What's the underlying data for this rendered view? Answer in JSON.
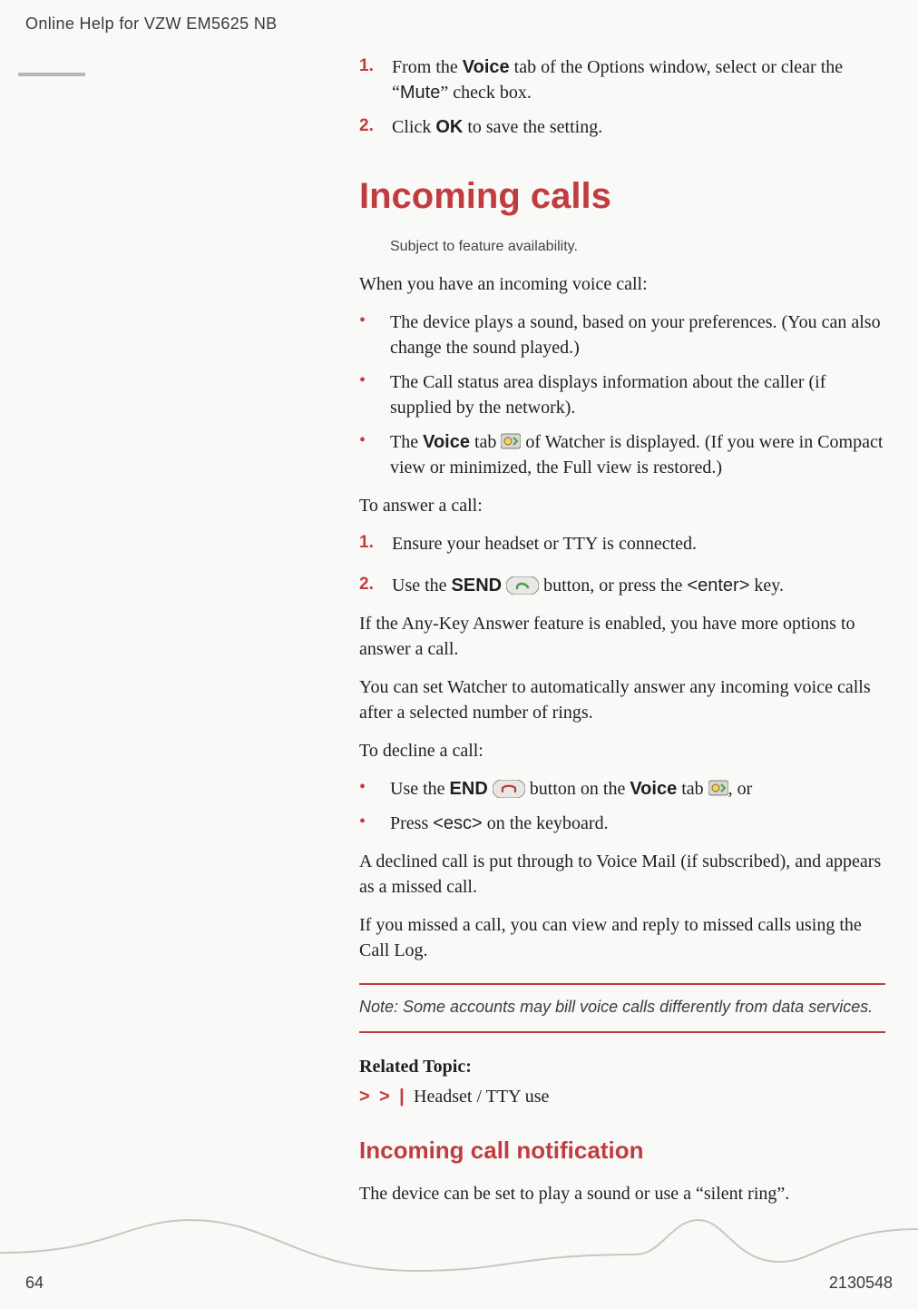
{
  "header": {
    "running_title": "Online Help for VZW EM5625 NB"
  },
  "intro_steps": [
    {
      "num": "1.",
      "pre": "From the ",
      "bold1": "Voice",
      "mid": " tab of the Options window, select or clear the “",
      "mono": "Mute",
      "post": "” check box."
    },
    {
      "num": "2.",
      "pre": "Click ",
      "bold1": "OK",
      "mid": "",
      "mono": "",
      "post": " to save the setting."
    }
  ],
  "h1": "Incoming calls",
  "sfa_note": "Subject to feature availability.",
  "incoming_intro": "When you have an incoming voice call:",
  "incoming_bullets": [
    "The device plays a sound, based on your preferences. (You can also change the sound played.)",
    "The Call status area displays information about the caller (if supplied by the network).",
    null
  ],
  "incoming_bullet3": {
    "pre": "The ",
    "bold": "Voice",
    "mid": " tab ",
    "post": " of Watcher is displayed. (If you were in Compact view or minimized, the Full view is restored.)"
  },
  "answer_intro": "To answer a call:",
  "answer_steps": [
    {
      "num": "1.",
      "text": "Ensure your headset or TTY is connected."
    },
    {
      "num": "2.",
      "pre": "Use the ",
      "bold": "SEND",
      "mid": " ",
      "after_icon": " button, or press the ",
      "mono": "<enter>",
      "post": " key."
    }
  ],
  "anykey": "If the Any-Key Answer feature is enabled, you have more options to answer a call.",
  "autoanswer": "You can set Watcher to automatically answer any incoming voice calls after a selected number of rings.",
  "decline_intro": "To decline a call:",
  "decline_bullets": {
    "b1": {
      "pre": "Use the ",
      "bold1": "END",
      "mid1": " ",
      "mid2": " button on the ",
      "bold2": "Voice",
      "mid3": " tab ",
      "post": ", or"
    },
    "b2": {
      "pre": "Press ",
      "mono": "<esc>",
      "post": " on the keyboard."
    }
  },
  "decline_result": "A declined call is put through to Voice Mail (if subscribed), and appears as a missed call.",
  "missed": "If you missed a call, you can view and reply to missed calls using the Call Log.",
  "note_block": {
    "label": "Note:  ",
    "text": "Some accounts may bill voice calls differently from data services."
  },
  "related": {
    "heading": "Related Topic:",
    "chev": "> > | ",
    "link": "Headset / TTY use"
  },
  "h2": "Incoming call notification",
  "notif_body": "The device can be set to play a sound or use a “silent ring”.",
  "footer": {
    "page": "64",
    "docnum": "2130548"
  },
  "icons": {
    "voice_tab": "voice-tab-icon",
    "send_pill": "send-icon",
    "end_pill": "end-icon"
  }
}
